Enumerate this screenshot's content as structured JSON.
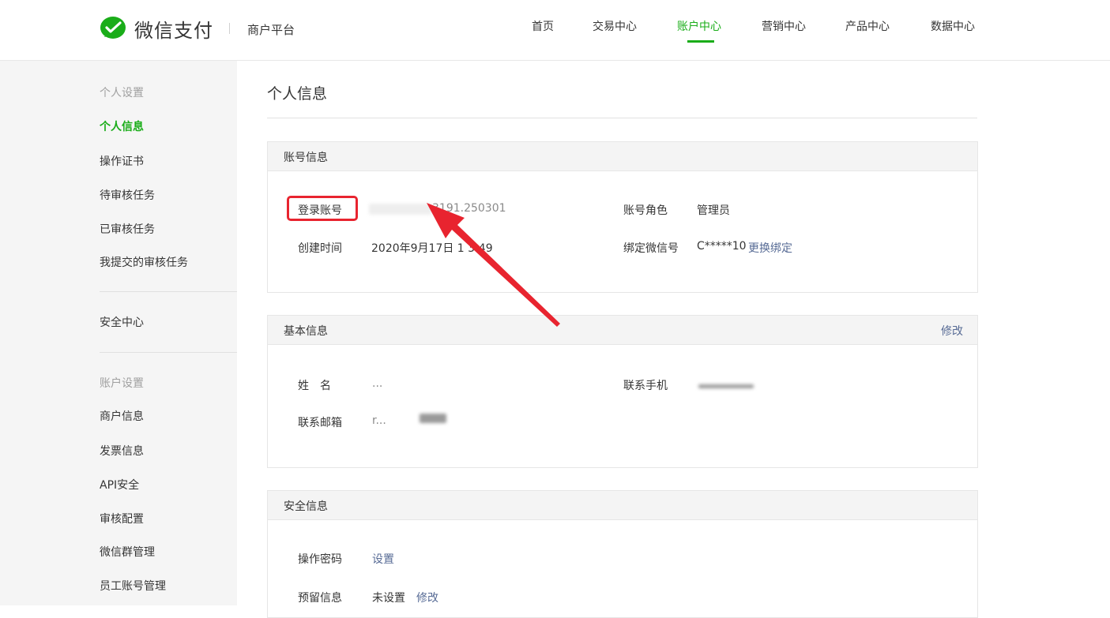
{
  "header": {
    "brand": "微信支付",
    "platform": "商户平台",
    "nav": [
      {
        "label": "首页"
      },
      {
        "label": "交易中心"
      },
      {
        "label": "账户中心",
        "active": true
      },
      {
        "label": "营销中心"
      },
      {
        "label": "产品中心"
      },
      {
        "label": "数据中心"
      }
    ]
  },
  "sidebar": {
    "group1": "个人设置",
    "items1": [
      "个人信息",
      "操作证书",
      "待审核任务",
      "已审核任务",
      "我提交的审核任务"
    ],
    "security": "安全中心",
    "group2": "账户设置",
    "items2": [
      "商户信息",
      "发票信息",
      "API安全",
      "审核配置",
      "微信群管理",
      "员工账号管理"
    ]
  },
  "main": {
    "title": "个人信息",
    "account": {
      "title": "账号信息",
      "login_label": "登录账号",
      "login_value": "3191.250301",
      "role_label": "账号角色",
      "role_value": "管理员",
      "created_label": "创建时间",
      "created_value": "2020年9月17日 1   3:49",
      "wechat_label": "绑定微信号",
      "wechat_value": "C*****10",
      "wechat_action": "更换绑定"
    },
    "basic": {
      "title": "基本信息",
      "action": "修改",
      "name_label": "姓　名",
      "name_value": "...",
      "phone_label": "联系手机",
      "email_label": "联系邮箱",
      "email_value": "r..."
    },
    "security": {
      "title": "安全信息",
      "pwd_label": "操作密码",
      "pwd_action": "设置",
      "reserved_label": "预留信息",
      "reserved_value": "未设置",
      "reserved_action": "修改"
    }
  },
  "colors": {
    "accent": "#1aad19",
    "link": "#576b95",
    "annotation": "#e8242f"
  }
}
